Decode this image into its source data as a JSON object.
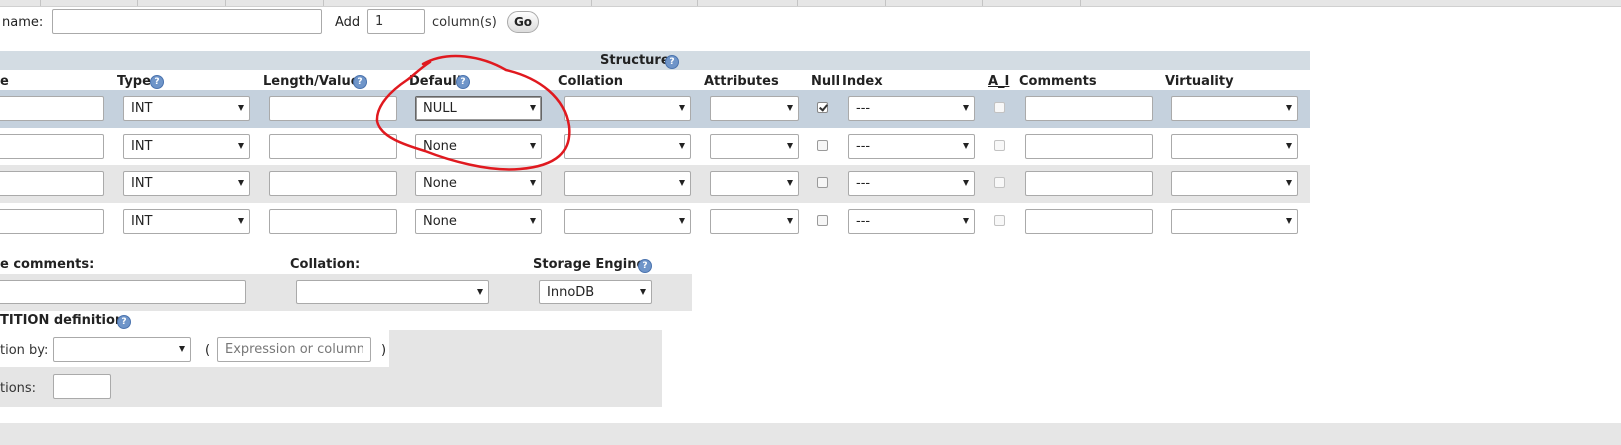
{
  "top_bar": {
    "table_name_label": "name:",
    "table_name_value": "",
    "add_label": "Add",
    "add_count": "1",
    "columns_label": "column(s)",
    "go_label": "Go"
  },
  "structure": {
    "section_title": "Structure",
    "headers": [
      "e",
      "Type",
      "Length/Values",
      "Default",
      "Collation",
      "Attributes",
      "Null",
      "Index",
      "A_I",
      "Comments",
      "Virtuality"
    ],
    "rows": [
      {
        "type": "INT",
        "default": "NULL",
        "null_checked": true,
        "index": "---"
      },
      {
        "type": "INT",
        "default": "None",
        "null_checked": false,
        "index": "---"
      },
      {
        "type": "INT",
        "default": "None",
        "null_checked": false,
        "index": "---"
      },
      {
        "type": "INT",
        "default": "None",
        "null_checked": false,
        "index": "---"
      }
    ]
  },
  "table_options": {
    "comments_label": "e comments:",
    "collation_label": "Collation:",
    "storage_engine_label": "Storage Engine:",
    "storage_engine_value": "InnoDB"
  },
  "partition": {
    "title": "TITION definition:",
    "partition_by_label": "tion by:",
    "open_paren": "(",
    "expression_placeholder": "Expression or column list",
    "close_paren": ")",
    "partitions_label": "tions:"
  },
  "colors": {
    "header_band": "#d3dce3",
    "row_selected": "#c5d1dd",
    "row_alt": "#e6e6e6",
    "options_band": "#e5e5e5",
    "annotation": "#e0191f"
  }
}
